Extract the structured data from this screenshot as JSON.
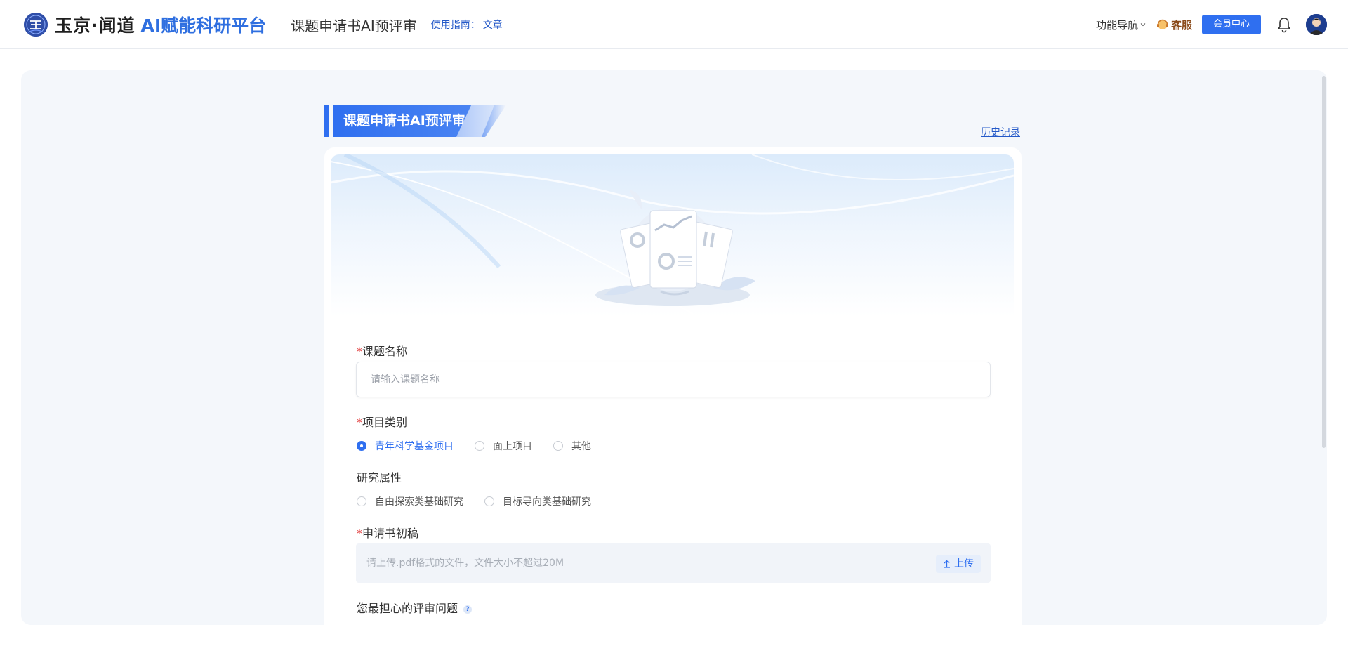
{
  "header": {
    "brand_main": "玉京·闻道",
    "brand_ai": "AI赋能科研平台",
    "page_name": "课题申请书AI预评审",
    "guide_label": "使用指南：",
    "guide_link": "文章",
    "nav_menu": "功能导航",
    "customer_service": "客服",
    "member_center": "会员中心"
  },
  "main": {
    "title": "课题申请书AI预评审",
    "history_link": "历史记录",
    "form": {
      "topic_name": {
        "required_mark": "*",
        "label": "课题名称",
        "placeholder": "请输入课题名称"
      },
      "project_category": {
        "required_mark": "*",
        "label": "项目类别",
        "options": [
          "青年科学基金项目",
          "面上项目",
          "其他"
        ],
        "selected": "青年科学基金项目"
      },
      "research_attribute": {
        "label": "研究属性",
        "options": [
          "自由探索类基础研究",
          "目标导向类基础研究"
        ]
      },
      "draft": {
        "required_mark": "*",
        "label": "申请书初稿",
        "hint": "请上传.pdf格式的文件，文件大小不超过20M",
        "upload_label": "上传"
      },
      "concern": {
        "label": "您最担心的评审问题",
        "help": "?"
      }
    }
  },
  "colors": {
    "accent": "#2f6ff0",
    "link": "#2459c8",
    "required": "#e23c3c",
    "panel_bg": "#f4f7fb"
  }
}
